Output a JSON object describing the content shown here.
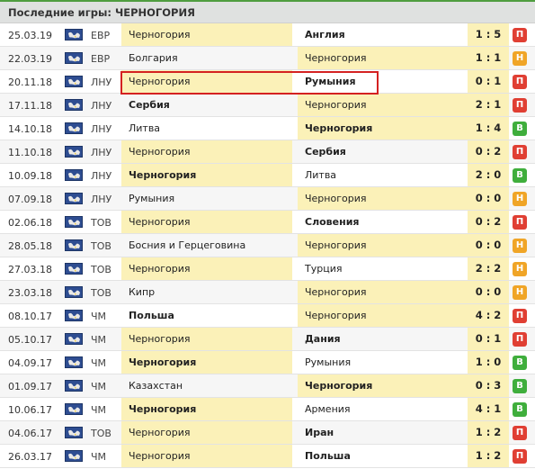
{
  "header": {
    "title": "Последние игры: ЧЕРНОГОРИЯ"
  },
  "colors": {
    "loss": "#e03f33",
    "draw": "#f0a527",
    "win": "#3fae3c",
    "highlight": "#fbf1b8",
    "accent": "#4f9d3f"
  },
  "matches": [
    {
      "date": "25.03.19",
      "comp": "ЕВР",
      "home": "Черногория",
      "away": "Англия",
      "score": "1 : 5",
      "result": "П",
      "type": "l",
      "winner": "away",
      "flag_icon": "world-flag-icon"
    },
    {
      "date": "22.03.19",
      "comp": "ЕВР",
      "home": "Болгария",
      "away": "Черногория",
      "score": "1 : 1",
      "result": "Н",
      "type": "d",
      "winner": "none",
      "flag_icon": "world-flag-icon"
    },
    {
      "date": "20.11.18",
      "comp": "ЛНУ",
      "home": "Черногория",
      "away": "Румыния",
      "score": "0 : 1",
      "result": "П",
      "type": "l",
      "winner": "away",
      "flag_icon": "world-flag-icon"
    },
    {
      "date": "17.11.18",
      "comp": "ЛНУ",
      "home": "Сербия",
      "away": "Черногория",
      "score": "2 : 1",
      "result": "П",
      "type": "l",
      "winner": "home",
      "flag_icon": "world-flag-icon"
    },
    {
      "date": "14.10.18",
      "comp": "ЛНУ",
      "home": "Литва",
      "away": "Черногория",
      "score": "1 : 4",
      "result": "В",
      "type": "w",
      "winner": "away",
      "flag_icon": "world-flag-icon"
    },
    {
      "date": "11.10.18",
      "comp": "ЛНУ",
      "home": "Черногория",
      "away": "Сербия",
      "score": "0 : 2",
      "result": "П",
      "type": "l",
      "winner": "away",
      "flag_icon": "world-flag-icon"
    },
    {
      "date": "10.09.18",
      "comp": "ЛНУ",
      "home": "Черногория",
      "away": "Литва",
      "score": "2 : 0",
      "result": "В",
      "type": "w",
      "winner": "home",
      "flag_icon": "world-flag-icon"
    },
    {
      "date": "07.09.18",
      "comp": "ЛНУ",
      "home": "Румыния",
      "away": "Черногория",
      "score": "0 : 0",
      "result": "Н",
      "type": "d",
      "winner": "none",
      "flag_icon": "world-flag-icon"
    },
    {
      "date": "02.06.18",
      "comp": "ТОВ",
      "home": "Черногория",
      "away": "Словения",
      "score": "0 : 2",
      "result": "П",
      "type": "l",
      "winner": "away",
      "flag_icon": "world-flag-icon"
    },
    {
      "date": "28.05.18",
      "comp": "ТОВ",
      "home": "Босния и Герцеговина",
      "away": "Черногория",
      "score": "0 : 0",
      "result": "Н",
      "type": "d",
      "winner": "none",
      "flag_icon": "world-flag-icon"
    },
    {
      "date": "27.03.18",
      "comp": "ТОВ",
      "home": "Черногория",
      "away": "Турция",
      "score": "2 : 2",
      "result": "Н",
      "type": "d",
      "winner": "none",
      "flag_icon": "world-flag-icon"
    },
    {
      "date": "23.03.18",
      "comp": "ТОВ",
      "home": "Кипр",
      "away": "Черногория",
      "score": "0 : 0",
      "result": "Н",
      "type": "d",
      "winner": "none",
      "flag_icon": "world-flag-icon"
    },
    {
      "date": "08.10.17",
      "comp": "ЧМ",
      "home": "Польша",
      "away": "Черногория",
      "score": "4 : 2",
      "result": "П",
      "type": "l",
      "winner": "home",
      "flag_icon": "world-flag-icon"
    },
    {
      "date": "05.10.17",
      "comp": "ЧМ",
      "home": "Черногория",
      "away": "Дания",
      "score": "0 : 1",
      "result": "П",
      "type": "l",
      "winner": "away",
      "flag_icon": "world-flag-icon"
    },
    {
      "date": "04.09.17",
      "comp": "ЧМ",
      "home": "Черногория",
      "away": "Румыния",
      "score": "1 : 0",
      "result": "В",
      "type": "w",
      "winner": "home",
      "flag_icon": "world-flag-icon"
    },
    {
      "date": "01.09.17",
      "comp": "ЧМ",
      "home": "Казахстан",
      "away": "Черногория",
      "score": "0 : 3",
      "result": "В",
      "type": "w",
      "winner": "away",
      "flag_icon": "world-flag-icon"
    },
    {
      "date": "10.06.17",
      "comp": "ЧМ",
      "home": "Черногория",
      "away": "Армения",
      "score": "4 : 1",
      "result": "В",
      "type": "w",
      "winner": "home",
      "flag_icon": "world-flag-icon"
    },
    {
      "date": "04.06.17",
      "comp": "ТОВ",
      "home": "Черногория",
      "away": "Иран",
      "score": "1 : 2",
      "result": "П",
      "type": "l",
      "winner": "away",
      "flag_icon": "world-flag-icon"
    },
    {
      "date": "26.03.17",
      "comp": "ЧМ",
      "home": "Черногория",
      "away": "Польша",
      "score": "1 : 2",
      "result": "П",
      "type": "l",
      "winner": "away",
      "flag_icon": "world-flag-icon"
    }
  ]
}
